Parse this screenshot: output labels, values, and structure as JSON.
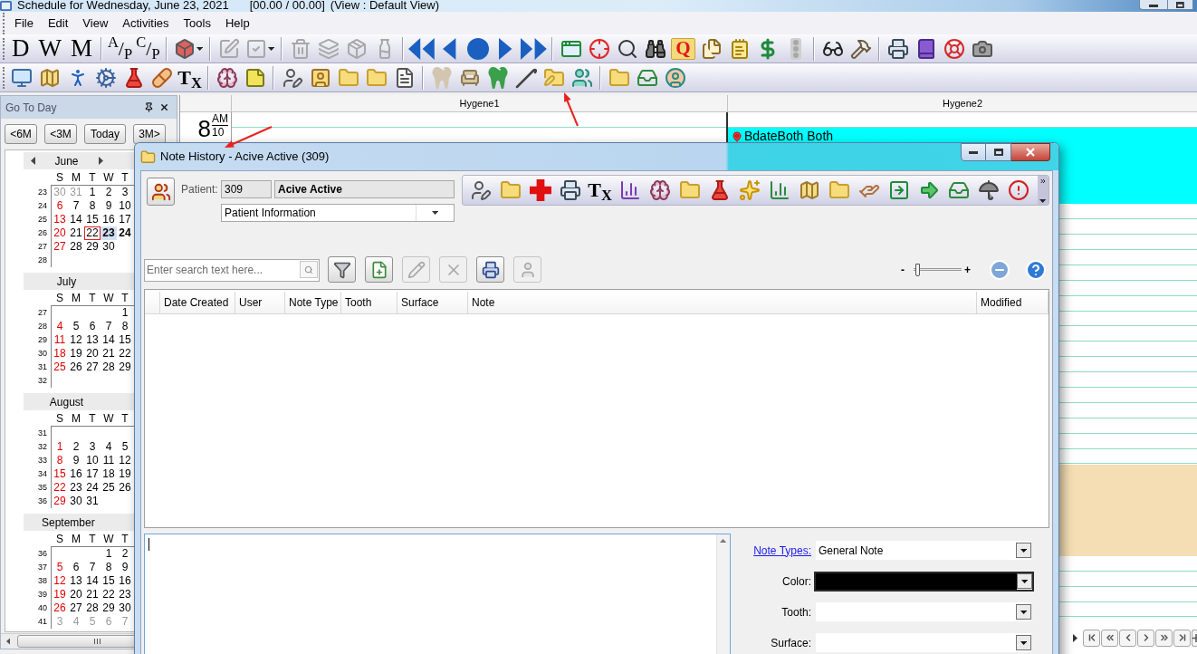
{
  "window": {
    "title": "Schedule for Wednesday, June 23, 2021",
    "totals": "[00.00 / 00.00]",
    "view": "(View : Default View)"
  },
  "menu": [
    "File",
    "Edit",
    "View",
    "Activities",
    "Tools",
    "Help"
  ],
  "main_toolbar": {
    "view_buttons": [
      "D",
      "W",
      "M"
    ],
    "ledger_buttons": [
      "$^{A}$/$_{P}$",
      "$^{C}$/$_{P}$"
    ],
    "icon_buttons": [
      {
        "disabled": false
      },
      {
        "disabled": true
      },
      {
        "disabled": true
      },
      {
        "disabled": true
      },
      {
        "disabled": true
      },
      {
        "disabled": true
      },
      {
        "disabled": true
      },
      {
        "disabled": false
      },
      {
        "disabled": false
      },
      {
        "disabled": false
      },
      {
        "disabled": false
      },
      {
        "disabled": false
      },
      {
        "disabled": false
      },
      {
        "disabled": false
      },
      {
        "disabled": false
      },
      {
        "disabled": false
      },
      {
        "disabled": false,
        "label": "Q"
      },
      {
        "disabled": false
      },
      {
        "disabled": false
      },
      {
        "disabled": false
      },
      {
        "disabled": true
      },
      {
        "disabled": false
      },
      {
        "disabled": false
      },
      {
        "disabled": false
      },
      {
        "disabled": false
      },
      {
        "disabled": false
      },
      {
        "disabled": false
      }
    ]
  },
  "module_toolbar": {
    "tx_button": "T$_{X}$"
  },
  "go_to_day": {
    "title": "Go To Day",
    "buttons": [
      "<6M",
      "<3M",
      "Today",
      "3M>"
    ],
    "months": [
      {
        "name": "June",
        "weekdays": [
          "S",
          "M",
          "T",
          "W",
          "T"
        ],
        "weeks": [
          {
            "week": "23",
            "days": [
              {
                "day": "30",
                "selected": false,
                "today": false,
                "bold": false,
                "outside": true
              },
              {
                "day": "31",
                "selected": false,
                "today": false,
                "bold": false,
                "outside": true
              },
              {
                "day": "1",
                "selected": false,
                "today": false,
                "bold": false,
                "outside": false
              },
              {
                "day": "2",
                "selected": false,
                "today": false,
                "bold": false,
                "outside": false
              },
              {
                "day": "3",
                "selected": false,
                "today": false,
                "bold": false,
                "outside": false
              }
            ]
          },
          {
            "week": "24",
            "days": [
              {
                "day": "6",
                "selected": false,
                "today": false,
                "bold": false,
                "outside": false
              },
              {
                "day": "7",
                "selected": false,
                "today": false,
                "bold": false,
                "outside": false
              },
              {
                "day": "8",
                "selected": false,
                "today": false,
                "bold": false,
                "outside": false
              },
              {
                "day": "9",
                "selected": false,
                "today": false,
                "bold": false,
                "outside": false
              },
              {
                "day": "10",
                "selected": false,
                "today": false,
                "bold": false,
                "outside": false
              }
            ]
          },
          {
            "week": "25",
            "days": [
              {
                "day": "13",
                "selected": false,
                "today": false,
                "bold": false,
                "outside": false
              },
              {
                "day": "14",
                "selected": false,
                "today": false,
                "bold": false,
                "outside": false
              },
              {
                "day": "15",
                "selected": false,
                "today": false,
                "bold": false,
                "outside": false
              },
              {
                "day": "16",
                "selected": false,
                "today": false,
                "bold": false,
                "outside": false
              },
              {
                "day": "17",
                "selected": false,
                "today": false,
                "bold": false,
                "outside": false
              }
            ]
          },
          {
            "week": "26",
            "days": [
              {
                "day": "20",
                "selected": false,
                "today": false,
                "bold": false,
                "outside": false
              },
              {
                "day": "21",
                "selected": false,
                "today": false,
                "bold": false,
                "outside": false
              },
              {
                "day": "22",
                "selected": false,
                "today": true,
                "bold": false,
                "outside": false
              },
              {
                "day": "23",
                "selected": true,
                "today": false,
                "bold": true,
                "outside": false
              },
              {
                "day": "24",
                "selected": false,
                "today": false,
                "bold": true,
                "outside": false
              }
            ]
          },
          {
            "week": "27",
            "days": [
              {
                "day": "27",
                "selected": false,
                "today": false,
                "bold": false,
                "outside": false
              },
              {
                "day": "28",
                "selected": false,
                "today": false,
                "bold": false,
                "outside": false
              },
              {
                "day": "29",
                "selected": false,
                "today": false,
                "bold": false,
                "outside": false
              },
              {
                "day": "30",
                "selected": false,
                "today": false,
                "bold": false,
                "outside": false
              }
            ]
          },
          {
            "week": "28"
          }
        ]
      },
      {
        "name": "July",
        "weekdays": [
          "S",
          "M",
          "T",
          "W",
          "T"
        ],
        "weeks": [
          {
            "week": "27",
            "days": [
              {
                "day": "1",
                "selected": false,
                "today": false,
                "bold": false,
                "outside": false
              }
            ]
          },
          {
            "week": "28",
            "days": [
              {
                "day": "4",
                "selected": false,
                "today": false,
                "bold": false,
                "outside": false
              },
              {
                "day": "5",
                "selected": false,
                "today": false,
                "bold": false,
                "outside": false
              },
              {
                "day": "6",
                "selected": false,
                "today": false,
                "bold": false,
                "outside": false
              },
              {
                "day": "7",
                "selected": false,
                "today": false,
                "bold": false,
                "outside": false
              },
              {
                "day": "8",
                "selected": false,
                "today": false,
                "bold": false,
                "outside": false
              }
            ]
          },
          {
            "week": "29",
            "days": [
              {
                "day": "11",
                "selected": false,
                "today": false,
                "bold": false,
                "outside": false
              },
              {
                "day": "12",
                "selected": false,
                "today": false,
                "bold": false,
                "outside": false
              },
              {
                "day": "13",
                "selected": false,
                "today": false,
                "bold": false,
                "outside": false
              },
              {
                "day": "14",
                "selected": false,
                "today": false,
                "bold": false,
                "outside": false
              },
              {
                "day": "15",
                "selected": false,
                "today": false,
                "bold": false,
                "outside": false
              }
            ]
          },
          {
            "week": "30",
            "days": [
              {
                "day": "18",
                "selected": false,
                "today": false,
                "bold": false,
                "outside": false
              },
              {
                "day": "19",
                "selected": false,
                "today": false,
                "bold": false,
                "outside": false
              },
              {
                "day": "20",
                "selected": false,
                "today": false,
                "bold": false,
                "outside": false
              },
              {
                "day": "21",
                "selected": false,
                "today": false,
                "bold": false,
                "outside": false
              },
              {
                "day": "22",
                "selected": false,
                "today": false,
                "bold": false,
                "outside": false
              }
            ]
          },
          {
            "week": "31",
            "days": [
              {
                "day": "25",
                "selected": false,
                "today": false,
                "bold": false,
                "outside": false
              },
              {
                "day": "26",
                "selected": false,
                "today": false,
                "bold": false,
                "outside": false
              },
              {
                "day": "27",
                "selected": false,
                "today": false,
                "bold": false,
                "outside": false
              },
              {
                "day": "28",
                "selected": false,
                "today": false,
                "bold": false,
                "outside": false
              },
              {
                "day": "29",
                "selected": false,
                "today": false,
                "bold": false,
                "outside": false
              }
            ]
          },
          {
            "week": "32"
          }
        ]
      },
      {
        "name": "August",
        "weekdays": [
          "S",
          "M",
          "T",
          "W",
          "T"
        ],
        "weeks": [
          {
            "week": "31"
          },
          {
            "week": "32",
            "days": [
              {
                "day": "1",
                "selected": false,
                "today": false,
                "bold": false,
                "outside": false
              },
              {
                "day": "2",
                "selected": false,
                "today": false,
                "bold": false,
                "outside": false
              },
              {
                "day": "3",
                "selected": false,
                "today": false,
                "bold": false,
                "outside": false
              },
              {
                "day": "4",
                "selected": false,
                "today": false,
                "bold": false,
                "outside": false
              },
              {
                "day": "5",
                "selected": false,
                "today": false,
                "bold": false,
                "outside": false
              }
            ]
          },
          {
            "week": "33",
            "days": [
              {
                "day": "8",
                "selected": false,
                "today": false,
                "bold": false,
                "outside": false
              },
              {
                "day": "9",
                "selected": false,
                "today": false,
                "bold": false,
                "outside": false
              },
              {
                "day": "10",
                "selected": false,
                "today": false,
                "bold": false,
                "outside": false
              },
              {
                "day": "11",
                "selected": false,
                "today": false,
                "bold": false,
                "outside": false
              },
              {
                "day": "12",
                "selected": false,
                "today": false,
                "bold": false,
                "outside": false
              }
            ]
          },
          {
            "week": "34",
            "days": [
              {
                "day": "15",
                "selected": false,
                "today": false,
                "bold": false,
                "outside": false
              },
              {
                "day": "16",
                "selected": false,
                "today": false,
                "bold": false,
                "outside": false
              },
              {
                "day": "17",
                "selected": false,
                "today": false,
                "bold": false,
                "outside": false
              },
              {
                "day": "18",
                "selected": false,
                "today": false,
                "bold": false,
                "outside": false
              },
              {
                "day": "19",
                "selected": false,
                "today": false,
                "bold": false,
                "outside": false
              }
            ]
          },
          {
            "week": "35",
            "days": [
              {
                "day": "22",
                "selected": false,
                "today": false,
                "bold": false,
                "outside": false
              },
              {
                "day": "23",
                "selected": false,
                "today": false,
                "bold": false,
                "outside": false
              },
              {
                "day": "24",
                "selected": false,
                "today": false,
                "bold": false,
                "outside": false
              },
              {
                "day": "25",
                "selected": false,
                "today": false,
                "bold": false,
                "outside": false
              },
              {
                "day": "26",
                "selected": false,
                "today": false,
                "bold": false,
                "outside": false
              }
            ]
          },
          {
            "week": "36",
            "days": [
              {
                "day": "29",
                "selected": false,
                "today": false,
                "bold": false,
                "outside": false
              },
              {
                "day": "30",
                "selected": false,
                "today": false,
                "bold": false,
                "outside": false
              },
              {
                "day": "31",
                "selected": false,
                "today": false,
                "bold": false,
                "outside": false
              }
            ]
          }
        ]
      },
      {
        "name": "September",
        "weekdays": [
          "S",
          "M",
          "T",
          "W",
          "T"
        ],
        "weeks": [
          {
            "week": "36",
            "days": [
              {
                "day": "1",
                "selected": false,
                "today": false,
                "bold": false,
                "outside": false
              },
              {
                "day": "2",
                "selected": false,
                "today": false,
                "bold": false,
                "outside": false
              }
            ]
          },
          {
            "week": "37",
            "days": [
              {
                "day": "5",
                "selected": false,
                "today": false,
                "bold": false,
                "outside": false
              },
              {
                "day": "6",
                "selected": false,
                "today": false,
                "bold": false,
                "outside": false
              },
              {
                "day": "7",
                "selected": false,
                "today": false,
                "bold": false,
                "outside": false
              },
              {
                "day": "8",
                "selected": false,
                "today": false,
                "bold": false,
                "outside": false
              },
              {
                "day": "9",
                "selected": false,
                "today": false,
                "bold": false,
                "outside": false
              }
            ]
          },
          {
            "week": "38",
            "days": [
              {
                "day": "12",
                "selected": false,
                "today": false,
                "bold": false,
                "outside": false
              },
              {
                "day": "13",
                "selected": false,
                "today": false,
                "bold": false,
                "outside": false
              },
              {
                "day": "14",
                "selected": false,
                "today": false,
                "bold": false,
                "outside": false
              },
              {
                "day": "15",
                "selected": false,
                "today": false,
                "bold": false,
                "outside": false
              },
              {
                "day": "16",
                "selected": false,
                "today": false,
                "bold": false,
                "outside": false
              }
            ]
          },
          {
            "week": "39",
            "days": [
              {
                "day": "19",
                "selected": false,
                "today": false,
                "bold": false,
                "outside": false
              },
              {
                "day": "20",
                "selected": false,
                "today": false,
                "bold": false,
                "outside": false
              },
              {
                "day": "21",
                "selected": false,
                "today": false,
                "bold": false,
                "outside": false
              },
              {
                "day": "22",
                "selected": false,
                "today": false,
                "bold": false,
                "outside": false
              },
              {
                "day": "23",
                "selected": false,
                "today": false,
                "bold": false,
                "outside": false
              }
            ]
          },
          {
            "week": "40",
            "days": [
              {
                "day": "26",
                "selected": false,
                "today": false,
                "bold": false,
                "outside": false
              },
              {
                "day": "27",
                "selected": false,
                "today": false,
                "bold": false,
                "outside": false
              },
              {
                "day": "28",
                "selected": false,
                "today": false,
                "bold": false,
                "outside": false
              },
              {
                "day": "29",
                "selected": false,
                "today": false,
                "bold": false,
                "outside": false
              },
              {
                "day": "30",
                "selected": false,
                "today": false,
                "bold": false,
                "outside": false
              }
            ]
          },
          {
            "week": "41",
            "days": [
              {
                "day": "3",
                "selected": false,
                "today": false,
                "bold": false,
                "outside": true
              },
              {
                "day": "4",
                "selected": false,
                "today": false,
                "bold": false,
                "outside": true
              },
              {
                "day": "5",
                "selected": false,
                "today": false,
                "bold": false,
                "outside": true
              },
              {
                "day": "6",
                "selected": false,
                "today": false,
                "bold": false,
                "outside": true
              },
              {
                "day": "7",
                "selected": false,
                "today": false,
                "bold": false,
                "outside": true
              }
            ]
          }
        ]
      }
    ]
  },
  "schedule": {
    "time": {
      "hour": "8",
      "meridiem": "AM",
      "minute": "10"
    },
    "columns": [
      {
        "name": "Hygene1"
      },
      {
        "name": "Hygene2",
        "appointments": [
          {
            "title": "BdateBoth Both",
            "color": "#00ffff"
          },
          {
            "color": "#f5deb3"
          }
        ]
      }
    ]
  },
  "dialog": {
    "title": "Note History - Acive Active (309)",
    "patient": {
      "label": "Patient:",
      "id": "309",
      "name": "Acive Active"
    },
    "view_select": {
      "value": "Patient Information"
    },
    "toolbar": {
      "tx_button": "T$_{X}$"
    },
    "search": {
      "placeholder": "Enter search text here..."
    },
    "actions": [
      {
        "disabled": false
      },
      {
        "disabled": false
      },
      {
        "disabled": true
      },
      {
        "disabled": true
      },
      {
        "disabled": false
      },
      {
        "disabled": true
      }
    ],
    "zoom": {
      "minus": "-",
      "plus": "+",
      "level": 0.08
    },
    "table": {
      "columns": [
        "Date Created",
        "User",
        "Note Type",
        "Tooth",
        "Surface",
        "Note",
        "Modified"
      ]
    },
    "note_editor": {
      "focused": true
    },
    "note_fields": [
      {
        "kind": "link",
        "label": "Note Types:",
        "value": "General Note"
      },
      {
        "kind": "color",
        "label": "Color:",
        "color": "#000000"
      },
      {
        "kind": "plain",
        "label": "Tooth:"
      },
      {
        "kind": "plain",
        "label": "Surface:"
      }
    ]
  }
}
